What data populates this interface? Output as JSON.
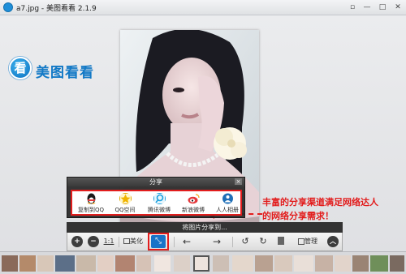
{
  "window": {
    "title": "a7.jpg - 美图看看 2.1.9",
    "controls": [
      "▫",
      "—",
      "□",
      "✕"
    ]
  },
  "logo": {
    "glyph": "看",
    "text": "美图看看"
  },
  "share_panel": {
    "title": "分享",
    "close": "×",
    "items": [
      {
        "label": "复制到QQ",
        "icon": "qq-penguin-icon",
        "color": "#1a1a1a"
      },
      {
        "label": "QQ空间",
        "icon": "qzone-star-icon",
        "color": "#f1b400"
      },
      {
        "label": "腾讯微博",
        "icon": "tencent-weibo-icon",
        "color": "#1ca0de"
      },
      {
        "label": "新浪微博",
        "icon": "sina-weibo-icon",
        "color": "#e4393c"
      },
      {
        "label": "人人相册",
        "icon": "renren-icon",
        "color": "#1f6fb7"
      }
    ],
    "share_to_label": "将图片分享到..."
  },
  "toolbar": {
    "zoom_in": "+",
    "zoom_out": "−",
    "actual_size": "1:1",
    "beautify_label": "美化",
    "share_icon": "share-icon",
    "prev": "←",
    "next": "→",
    "rotate_left": "↺",
    "rotate_right": "↻",
    "delete": "🗑",
    "manage_label": "管理",
    "collapse": "︿"
  },
  "annotation": {
    "line1": "丰富的分享渠道满足网络达人",
    "line2": "的网络分享需求！"
  },
  "colors": {
    "highlight": "#e21d1d",
    "brand": "#1279c6"
  }
}
